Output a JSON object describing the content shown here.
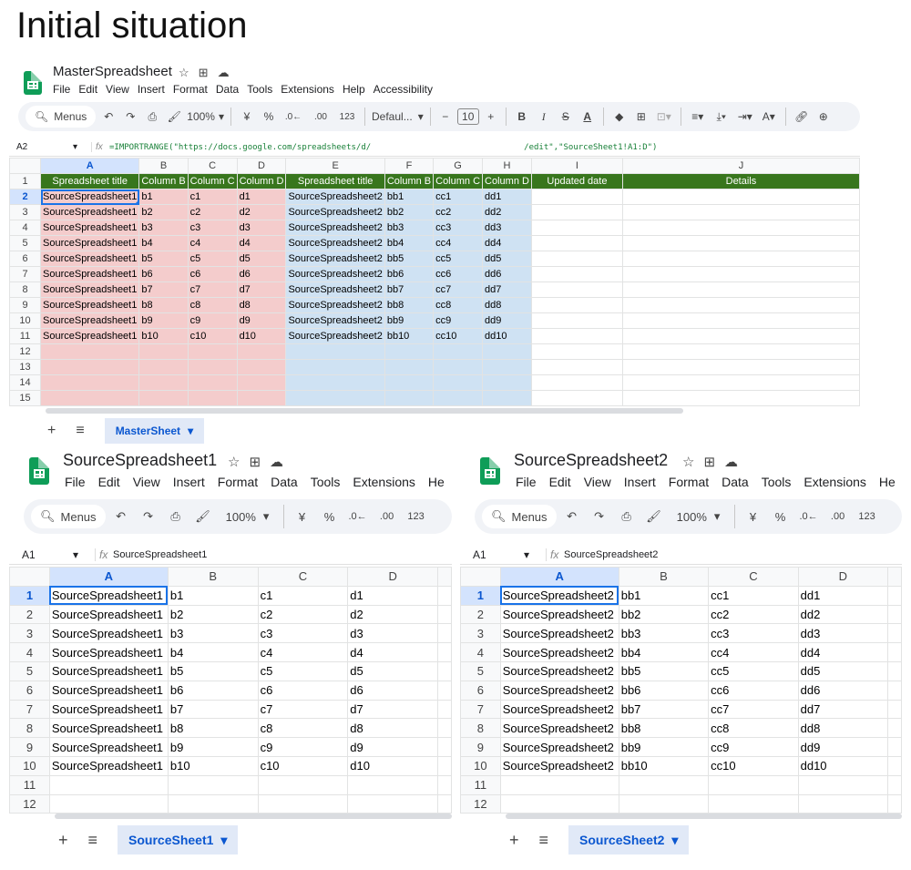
{
  "heading": "Initial situation",
  "master": {
    "title": "MasterSpreadsheet",
    "menu": [
      "File",
      "Edit",
      "View",
      "Insert",
      "Format",
      "Data",
      "Tools",
      "Extensions",
      "Help",
      "Accessibility"
    ],
    "toolbar": {
      "menus": "Menus",
      "zoom": "100%",
      "currency": "¥",
      "percent": "%",
      "dec_down": ".0←",
      "dec_up": ".00",
      "format123": "123",
      "font": "Defaul...",
      "font_size": "10"
    },
    "cell_ref": "A2",
    "formula": "=IMPORTRANGE(\"https://docs.google.com/spreadsheets/d/                               /edit\",\"SourceSheet1!A1:D\")",
    "columns": [
      "A",
      "B",
      "C",
      "D",
      "E",
      "F",
      "G",
      "H",
      "I",
      "J"
    ],
    "header_row": [
      "Spreadsheet title",
      "Column B",
      "Column C",
      "Column D",
      "Spreadsheet title",
      "Column B",
      "Column C",
      "Column D",
      "Updated date",
      "Details"
    ],
    "rows": [
      [
        "SourceSpreadsheet1",
        "b1",
        "c1",
        "d1",
        "SourceSpreadsheet2",
        "bb1",
        "cc1",
        "dd1",
        "",
        ""
      ],
      [
        "SourceSpreadsheet1",
        "b2",
        "c2",
        "d2",
        "SourceSpreadsheet2",
        "bb2",
        "cc2",
        "dd2",
        "",
        ""
      ],
      [
        "SourceSpreadsheet1",
        "b3",
        "c3",
        "d3",
        "SourceSpreadsheet2",
        "bb3",
        "cc3",
        "dd3",
        "",
        ""
      ],
      [
        "SourceSpreadsheet1",
        "b4",
        "c4",
        "d4",
        "SourceSpreadsheet2",
        "bb4",
        "cc4",
        "dd4",
        "",
        ""
      ],
      [
        "SourceSpreadsheet1",
        "b5",
        "c5",
        "d5",
        "SourceSpreadsheet2",
        "bb5",
        "cc5",
        "dd5",
        "",
        ""
      ],
      [
        "SourceSpreadsheet1",
        "b6",
        "c6",
        "d6",
        "SourceSpreadsheet2",
        "bb6",
        "cc6",
        "dd6",
        "",
        ""
      ],
      [
        "SourceSpreadsheet1",
        "b7",
        "c7",
        "d7",
        "SourceSpreadsheet2",
        "bb7",
        "cc7",
        "dd7",
        "",
        ""
      ],
      [
        "SourceSpreadsheet1",
        "b8",
        "c8",
        "d8",
        "SourceSpreadsheet2",
        "bb8",
        "cc8",
        "dd8",
        "",
        ""
      ],
      [
        "SourceSpreadsheet1",
        "b9",
        "c9",
        "d9",
        "SourceSpreadsheet2",
        "bb9",
        "cc9",
        "dd9",
        "",
        ""
      ],
      [
        "SourceSpreadsheet1",
        "b10",
        "c10",
        "d10",
        "SourceSpreadsheet2",
        "bb10",
        "cc10",
        "dd10",
        "",
        ""
      ],
      [
        "",
        "",
        "",
        "",
        "",
        "",
        "",
        "",
        "",
        ""
      ],
      [
        "",
        "",
        "",
        "",
        "",
        "",
        "",
        "",
        "",
        ""
      ],
      [
        "",
        "",
        "",
        "",
        "",
        "",
        "",
        "",
        "",
        ""
      ],
      [
        "",
        "",
        "",
        "",
        "",
        "",
        "",
        "",
        "",
        ""
      ]
    ],
    "row_numbers": [
      "1",
      "2",
      "3",
      "4",
      "5",
      "6",
      "7",
      "8",
      "9",
      "10",
      "11",
      "12",
      "13",
      "14",
      "15"
    ],
    "sheet_tab": "MasterSheet",
    "colors": {
      "header_green": "#38761d",
      "pink": "#f4cccc",
      "blue": "#cfe2f3"
    }
  },
  "source1": {
    "title": "SourceSpreadsheet1",
    "menu": [
      "File",
      "Edit",
      "View",
      "Insert",
      "Format",
      "Data",
      "Tools",
      "Extensions",
      "He"
    ],
    "toolbar": {
      "menus": "Menus",
      "zoom": "100%",
      "currency": "¥",
      "percent": "%",
      "dec_down": ".0←",
      "dec_up": ".00",
      "format123": "123"
    },
    "cell_ref": "A1",
    "formula": "SourceSpreadsheet1",
    "columns": [
      "A",
      "B",
      "C",
      "D"
    ],
    "rows": [
      [
        "SourceSpreadsheet1",
        "b1",
        "c1",
        "d1"
      ],
      [
        "SourceSpreadsheet1",
        "b2",
        "c2",
        "d2"
      ],
      [
        "SourceSpreadsheet1",
        "b3",
        "c3",
        "d3"
      ],
      [
        "SourceSpreadsheet1",
        "b4",
        "c4",
        "d4"
      ],
      [
        "SourceSpreadsheet1",
        "b5",
        "c5",
        "d5"
      ],
      [
        "SourceSpreadsheet1",
        "b6",
        "c6",
        "d6"
      ],
      [
        "SourceSpreadsheet1",
        "b7",
        "c7",
        "d7"
      ],
      [
        "SourceSpreadsheet1",
        "b8",
        "c8",
        "d8"
      ],
      [
        "SourceSpreadsheet1",
        "b9",
        "c9",
        "d9"
      ],
      [
        "SourceSpreadsheet1",
        "b10",
        "c10",
        "d10"
      ],
      [
        "",
        "",
        "",
        ""
      ],
      [
        "",
        "",
        "",
        ""
      ]
    ],
    "row_numbers": [
      "1",
      "2",
      "3",
      "4",
      "5",
      "6",
      "7",
      "8",
      "9",
      "10",
      "11",
      "12"
    ],
    "sheet_tab": "SourceSheet1"
  },
  "source2": {
    "title": "SourceSpreadsheet2",
    "menu": [
      "File",
      "Edit",
      "View",
      "Insert",
      "Format",
      "Data",
      "Tools",
      "Extensions",
      "He"
    ],
    "toolbar": {
      "menus": "Menus",
      "zoom": "100%",
      "currency": "¥",
      "percent": "%",
      "dec_down": ".0←",
      "dec_up": ".00",
      "format123": "123"
    },
    "cell_ref": "A1",
    "formula": "SourceSpreadsheet2",
    "columns": [
      "A",
      "B",
      "C",
      "D"
    ],
    "rows": [
      [
        "SourceSpreadsheet2",
        "bb1",
        "cc1",
        "dd1"
      ],
      [
        "SourceSpreadsheet2",
        "bb2",
        "cc2",
        "dd2"
      ],
      [
        "SourceSpreadsheet2",
        "bb3",
        "cc3",
        "dd3"
      ],
      [
        "SourceSpreadsheet2",
        "bb4",
        "cc4",
        "dd4"
      ],
      [
        "SourceSpreadsheet2",
        "bb5",
        "cc5",
        "dd5"
      ],
      [
        "SourceSpreadsheet2",
        "bb6",
        "cc6",
        "dd6"
      ],
      [
        "SourceSpreadsheet2",
        "bb7",
        "cc7",
        "dd7"
      ],
      [
        "SourceSpreadsheet2",
        "bb8",
        "cc8",
        "dd8"
      ],
      [
        "SourceSpreadsheet2",
        "bb9",
        "cc9",
        "dd9"
      ],
      [
        "SourceSpreadsheet2",
        "bb10",
        "cc10",
        "dd10"
      ],
      [
        "",
        "",
        "",
        ""
      ],
      [
        "",
        "",
        "",
        ""
      ]
    ],
    "row_numbers": [
      "1",
      "2",
      "3",
      "4",
      "5",
      "6",
      "7",
      "8",
      "9",
      "10",
      "11",
      "12"
    ],
    "sheet_tab": "SourceSheet2"
  },
  "icons": [
    "star-icon",
    "move-folder-icon",
    "cloud-icon",
    "search-icon",
    "undo-icon",
    "redo-icon",
    "print-icon",
    "paint-format-icon",
    "chevron-down-icon",
    "add-sheet-icon",
    "all-sheets-icon",
    "fx-icon"
  ]
}
